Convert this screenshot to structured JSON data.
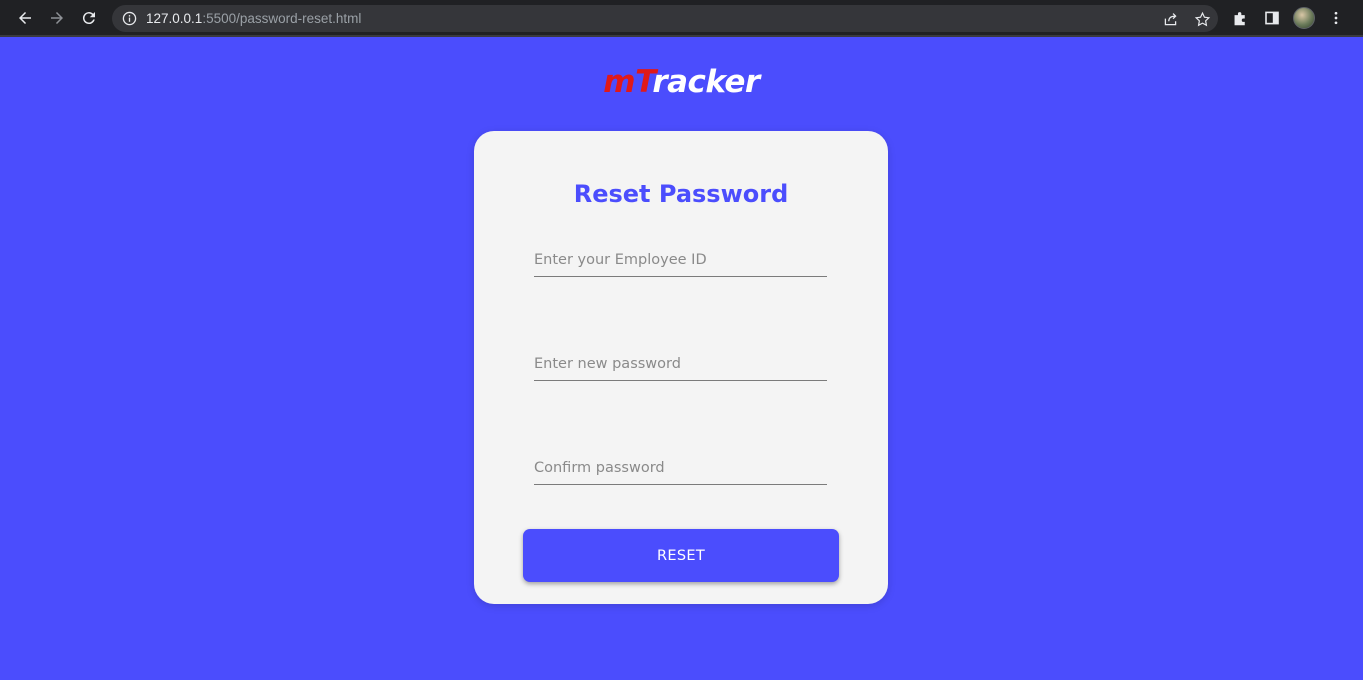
{
  "browser": {
    "url_host": "127.0.0.1",
    "url_rest": ":5500/password-reset.html",
    "icons": [
      "back-arrow-icon",
      "forward-arrow-icon",
      "reload-icon",
      "info-icon",
      "share-icon",
      "star-icon",
      "puzzle-icon",
      "side-panel-icon",
      "profile-avatar",
      "kebab-menu-icon"
    ]
  },
  "logo": {
    "m": "m",
    "t": "T",
    "rest": "racker"
  },
  "form": {
    "title": "Reset Password",
    "employee_id_placeholder": "Enter your Employee ID",
    "new_password_placeholder": "Enter new password",
    "confirm_password_placeholder": "Confirm password",
    "reset_label": "RESET"
  },
  "colors": {
    "background": "#4b4dfd",
    "card": "#f4f4f4",
    "accent": "#4b4dfd",
    "logo_red": "#e01919"
  }
}
